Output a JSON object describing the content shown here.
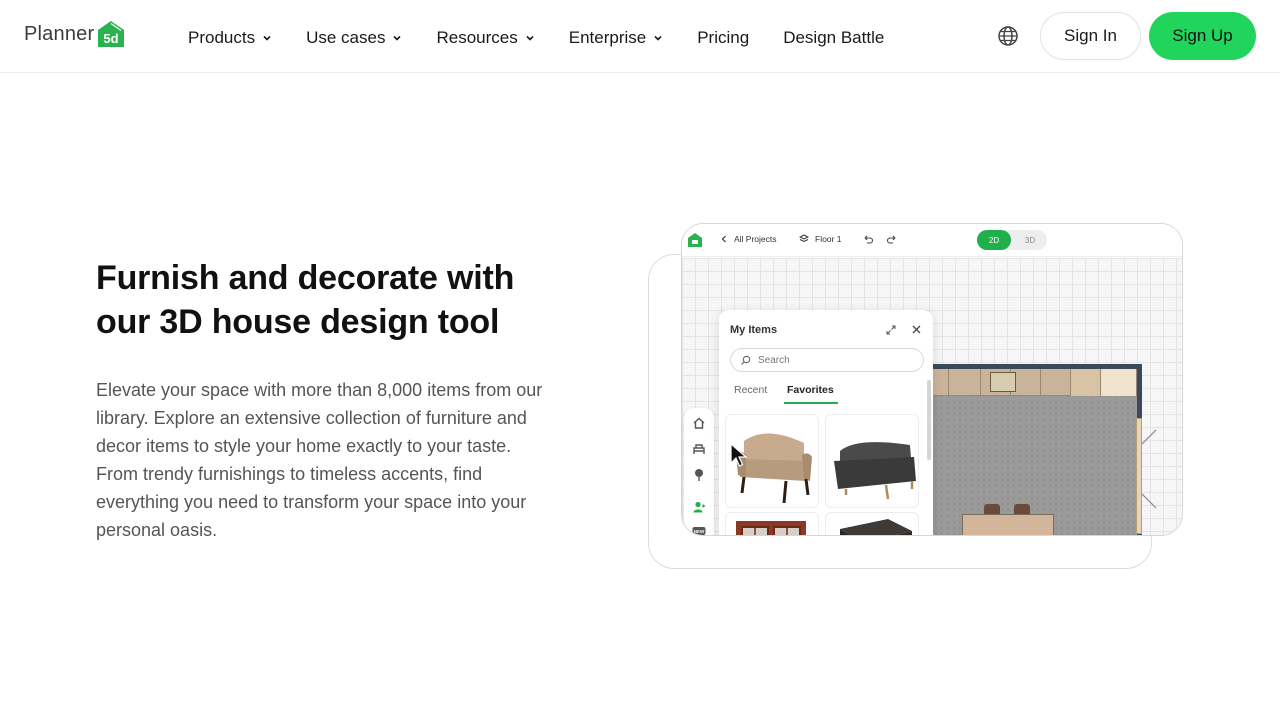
{
  "brand": {
    "name": "Planner",
    "mark_text": "5d",
    "accent": "#21d45b"
  },
  "nav": {
    "items": [
      {
        "label": "Products",
        "has_dropdown": true
      },
      {
        "label": "Use cases",
        "has_dropdown": true
      },
      {
        "label": "Resources",
        "has_dropdown": true
      },
      {
        "label": "Enterprise",
        "has_dropdown": true
      },
      {
        "label": "Pricing",
        "has_dropdown": false
      },
      {
        "label": "Design Battle",
        "has_dropdown": false
      }
    ],
    "language_icon": "globe-icon",
    "sign_in": "Sign In",
    "sign_up": "Sign Up"
  },
  "hero": {
    "headline": "Furnish and decorate with our 3D house design tool",
    "body": "Elevate your space with more than 8,000 items from our library. Explore an extensive collection of furniture and decor items to style your home exactly to your taste. From trendy furnishings to timeless accents, find everything you need to transform your space into your personal oasis."
  },
  "app_preview": {
    "breadcrumb": "All Projects",
    "floor": "Floor 1",
    "view_2d": "2D",
    "view_3d": "3D",
    "active_view": "2D",
    "panel": {
      "title": "My Items",
      "search_placeholder": "Search",
      "tabs": [
        "Recent",
        "Favorites"
      ],
      "active_tab": "Favorites",
      "items": [
        "beige-loveseat",
        "dark-gray-sofa",
        "wooden-double-door",
        "marble-top-table"
      ]
    },
    "tools": [
      "home-icon",
      "furniture-icon",
      "plant-icon",
      "user-icon",
      "new-icon"
    ]
  }
}
